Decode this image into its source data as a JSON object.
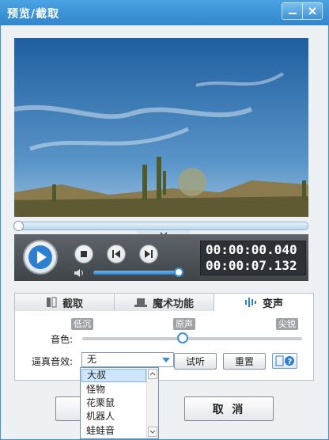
{
  "window": {
    "title": "预览/截取"
  },
  "player": {
    "current_time": "00:00:00.040",
    "total_time": "00:00:07.132",
    "volume_level": 0.92,
    "progress": 0.0
  },
  "tabs": [
    {
      "label": "截取",
      "icon": "film-cut-icon",
      "active": false
    },
    {
      "label": "魔术功能",
      "icon": "magic-hat-icon",
      "active": false
    },
    {
      "label": "变声",
      "icon": "sound-wave-icon",
      "active": true
    }
  ],
  "voice": {
    "tone_label": "音色:",
    "tone_low": "低沉",
    "tone_mid": "原声",
    "tone_high": "尖锐",
    "tone_value": 0.5,
    "effect_label": "逼真音效:",
    "effect_selected": "无",
    "listen_button": "试听",
    "reset_button": "重置",
    "help_icon": "help-icon",
    "options": [
      "大叔",
      "怪物",
      "花栗鼠",
      "机器人",
      "蛙蛙音"
    ]
  },
  "footer": {
    "cancel_button": "取 消"
  },
  "colors": {
    "titlebar": "#3a8fd6",
    "accent": "#3d8fd2",
    "controls": "#4c5157"
  }
}
